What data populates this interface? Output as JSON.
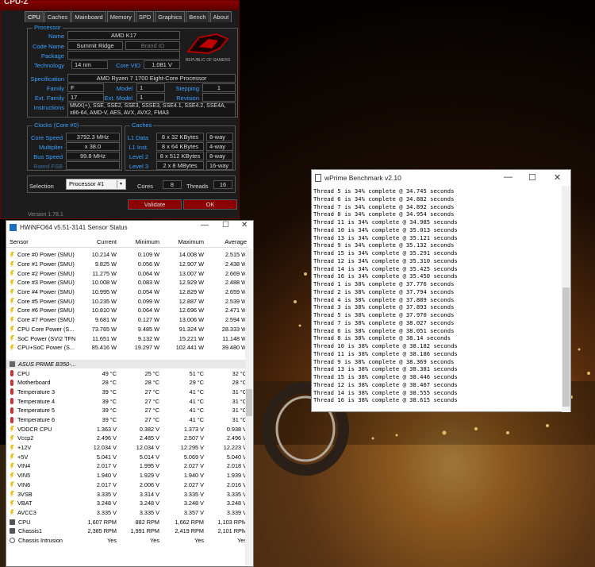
{
  "cpuz": {
    "title": "CPU-Z",
    "tabs": [
      "CPU",
      "Caches",
      "Mainboard",
      "Memory",
      "SPD",
      "Graphics",
      "Bench",
      "About"
    ],
    "processor": {
      "group": "Processor",
      "name_label": "Name",
      "name": "AMD K17",
      "codename_label": "Code Name",
      "codename": "Summit Ridge",
      "brand_label": "Brand ID",
      "package_label": "Package",
      "package": "",
      "tech_label": "Technology",
      "tech": "14 nm",
      "vid_label": "Core VID",
      "vid": "1.081 V",
      "spec_label": "Specification",
      "spec": "AMD Ryzen 7 1700 Eight-Core Processor",
      "family_label": "Family",
      "family": "F",
      "model_label": "Model",
      "model": "1",
      "stepping_label": "Stepping",
      "stepping": "1",
      "extfamily_label": "Ext. Family",
      "extfamily": "17",
      "extmodel_label": "Ext. Model",
      "extmodel": "1",
      "revision_label": "Revision",
      "revision": "",
      "instr_label": "Instructions",
      "instr1": "MMX(+), SSE, SSE2, SSE3, SSSE3, SSE4.1, SSE4.2, SSE4A,",
      "instr2": "x86-64, AMD-V, AES, AVX, AVX2, FMA3",
      "logo": "REPUBLIC OF GAMERS"
    },
    "clocks": {
      "group": "Clocks (Core #0)",
      "speed_label": "Core Speed",
      "speed": "3792.3 MHz",
      "mult_label": "Multiplier",
      "mult": "x 38.0",
      "bus_label": "Bus Speed",
      "bus": "99.8 MHz",
      "fsb_label": "Rated FSB",
      "fsb": ""
    },
    "caches": {
      "group": "Caches",
      "l1d_label": "L1 Data",
      "l1d": "8 x 32 KBytes",
      "l1d_way": "8-way",
      "l1i_label": "L1 Inst.",
      "l1i": "8 x 64 KBytes",
      "l1i_way": "4-way",
      "l2_label": "Level 2",
      "l2": "8 x 512 KBytes",
      "l2_way": "8-way",
      "l3_label": "Level 3",
      "l3": "2 x 8 MBytes",
      "l3_way": "16-way"
    },
    "selection_label": "Selection",
    "selection": "Processor #1",
    "cores_label": "Cores",
    "cores": "8",
    "threads_label": "Threads",
    "threads": "16",
    "validate": "Validate",
    "ok": "OK",
    "version": "Version 1.78.1"
  },
  "hwinfo": {
    "title": "HWiNFO64 v5.51-3141 Sensor Status",
    "headers": [
      "Sensor",
      "Current",
      "Minimum",
      "Maximum",
      "Average"
    ],
    "rows": [
      {
        "icon": "bolt",
        "name": "Core #0 Power (SMU)",
        "cur": "10.214 W",
        "min": "0.109 W",
        "max": "14.008 W",
        "avg": "2.515 W"
      },
      {
        "icon": "bolt",
        "name": "Core #1 Power (SMU)",
        "cur": "9.825 W",
        "min": "0.056 W",
        "max": "12.907 W",
        "avg": "2.438 W"
      },
      {
        "icon": "bolt",
        "name": "Core #2 Power (SMU)",
        "cur": "11.275 W",
        "min": "0.064 W",
        "max": "13.007 W",
        "avg": "2.669 W"
      },
      {
        "icon": "bolt",
        "name": "Core #3 Power (SMU)",
        "cur": "10.008 W",
        "min": "0.083 W",
        "max": "12.929 W",
        "avg": "2.488 W"
      },
      {
        "icon": "bolt",
        "name": "Core #4 Power (SMU)",
        "cur": "10.995 W",
        "min": "0.054 W",
        "max": "12.829 W",
        "avg": "2.659 W"
      },
      {
        "icon": "bolt",
        "name": "Core #5 Power (SMU)",
        "cur": "10.235 W",
        "min": "0.099 W",
        "max": "12.887 W",
        "avg": "2.539 W"
      },
      {
        "icon": "bolt",
        "name": "Core #6 Power (SMU)",
        "cur": "10.810 W",
        "min": "0.064 W",
        "max": "12.696 W",
        "avg": "2.471 W"
      },
      {
        "icon": "bolt",
        "name": "Core #7 Power (SMU)",
        "cur": "9.681 W",
        "min": "0.127 W",
        "max": "13.006 W",
        "avg": "2.594 W"
      },
      {
        "icon": "bolt",
        "name": "CPU Core Power (S...",
        "cur": "73.765 W",
        "min": "9.485 W",
        "max": "91.324 W",
        "avg": "28.333 W"
      },
      {
        "icon": "bolt",
        "name": "SoC Power (SVI2 TFN)",
        "cur": "11.651 W",
        "min": "9.132 W",
        "max": "15.221 W",
        "avg": "11.148 W"
      },
      {
        "icon": "bolt",
        "name": "CPU+SoC Power (S...",
        "cur": "85.416 W",
        "min": "19.297 W",
        "max": "102.441 W",
        "avg": "39.480 W"
      },
      {
        "type": "gap"
      },
      {
        "type": "sect",
        "icon": "chip",
        "name": "ASUS PRIME B350-...",
        "cur": "",
        "min": "",
        "max": "",
        "avg": ""
      },
      {
        "icon": "therm",
        "name": "CPU",
        "cur": "49 °C",
        "min": "25 °C",
        "max": "51 °C",
        "avg": "32 °C"
      },
      {
        "icon": "therm",
        "name": "Motherboard",
        "cur": "28 °C",
        "min": "28 °C",
        "max": "29 °C",
        "avg": "28 °C"
      },
      {
        "icon": "therm",
        "name": "Temperature 3",
        "cur": "39 °C",
        "min": "27 °C",
        "max": "41 °C",
        "avg": "31 °C"
      },
      {
        "icon": "therm",
        "name": "Temperature 4",
        "cur": "39 °C",
        "min": "27 °C",
        "max": "41 °C",
        "avg": "31 °C"
      },
      {
        "icon": "therm",
        "name": "Temperature 5",
        "cur": "39 °C",
        "min": "27 °C",
        "max": "41 °C",
        "avg": "31 °C"
      },
      {
        "icon": "therm",
        "name": "Temperature 6",
        "cur": "39 °C",
        "min": "27 °C",
        "max": "41 °C",
        "avg": "31 °C"
      },
      {
        "icon": "bolt",
        "name": "VDDCR CPU",
        "cur": "1.363 V",
        "min": "0.382 V",
        "max": "1.373 V",
        "avg": "0.938 V"
      },
      {
        "icon": "bolt",
        "name": "Vccp2",
        "cur": "2.496 V",
        "min": "2.485 V",
        "max": "2.507 V",
        "avg": "2.496 V"
      },
      {
        "icon": "bolt",
        "name": "+12V",
        "cur": "12.034 V",
        "min": "12.034 V",
        "max": "12.295 V",
        "avg": "12.223 V"
      },
      {
        "icon": "bolt",
        "name": "+5V",
        "cur": "5.041 V",
        "min": "5.014 V",
        "max": "5.069 V",
        "avg": "5.040 V"
      },
      {
        "icon": "bolt",
        "name": "VIN4",
        "cur": "2.017 V",
        "min": "1.995 V",
        "max": "2.027 V",
        "avg": "2.018 V"
      },
      {
        "icon": "bolt",
        "name": "VIN5",
        "cur": "1.940 V",
        "min": "1.929 V",
        "max": "1.940 V",
        "avg": "1.939 V"
      },
      {
        "icon": "bolt",
        "name": "VIN6",
        "cur": "2.017 V",
        "min": "2.006 V",
        "max": "2.027 V",
        "avg": "2.016 V"
      },
      {
        "icon": "bolt",
        "name": "3VSB",
        "cur": "3.335 V",
        "min": "3.314 V",
        "max": "3.335 V",
        "avg": "3.335 V"
      },
      {
        "icon": "bolt",
        "name": "VBAT",
        "cur": "3.248 V",
        "min": "3.248 V",
        "max": "3.248 V",
        "avg": "3.248 V"
      },
      {
        "icon": "bolt",
        "name": "AVCC3",
        "cur": "3.335 V",
        "min": "3.335 V",
        "max": "3.357 V",
        "avg": "3.339 V"
      },
      {
        "icon": "fan",
        "name": "CPU",
        "cur": "1,607 RPM",
        "min": "882 RPM",
        "max": "1,662 RPM",
        "avg": "1,103 RPM"
      },
      {
        "icon": "fan",
        "name": "Chassis1",
        "cur": "2,385 RPM",
        "min": "1,991 RPM",
        "max": "2,419 RPM",
        "avg": "2,101 RPM"
      },
      {
        "icon": "circle",
        "name": "Chassis Intrusion",
        "cur": "Yes",
        "min": "Yes",
        "max": "Yes",
        "avg": "Yes"
      }
    ]
  },
  "wprime": {
    "title": "wPrime Benchmark v2.10",
    "lines": [
      "Thread 5 is 34% complete @ 34.745 seconds",
      "Thread 6 is 34% complete @ 34.882 seconds",
      "Thread 7 is 34% complete @ 34.892 seconds",
      "Thread 8 is 34% complete @ 34.954 seconds",
      "Thread 11 is 34% complete @ 34.985 seconds",
      "Thread 10 is 34% complete @ 35.013 seconds",
      "Thread 13 is 34% complete @ 35.121 seconds",
      "Thread 9 is 34% complete @ 35.132 seconds",
      "Thread 15 is 34% complete @ 35.291 seconds",
      "Thread 12 is 34% complete @ 35.310 seconds",
      "Thread 14 is 34% complete @ 35.425 seconds",
      "Thread 16 is 34% complete @ 35.450 seconds",
      "Thread 1 is 38% complete @ 37.776 seconds",
      "Thread 2 is 38% complete @ 37.794 seconds",
      "Thread 4 is 38% complete @ 37.889 seconds",
      "Thread 3 is 38% complete @ 37.893 seconds",
      "Thread 5 is 38% complete @ 37.970 seconds",
      "Thread 7 is 38% complete @ 38.027 seconds",
      "Thread 6 is 38% complete @ 38.051 seconds",
      "Thread 8 is 38% complete @ 38.14 seconds",
      "Thread 10 is 38% complete @ 38.182 seconds",
      "Thread 11 is 38% complete @ 38.186 seconds",
      "Thread 9 is 38% complete @ 38.369 seconds",
      "Thread 13 is 38% complete @ 38.381 seconds",
      "Thread 15 is 38% complete @ 38.446 seconds",
      "Thread 12 is 38% complete @ 38.467 seconds",
      "Thread 14 is 38% complete @ 38.555 seconds",
      "Thread 16 is 38% complete @ 38.615 seconds"
    ]
  }
}
